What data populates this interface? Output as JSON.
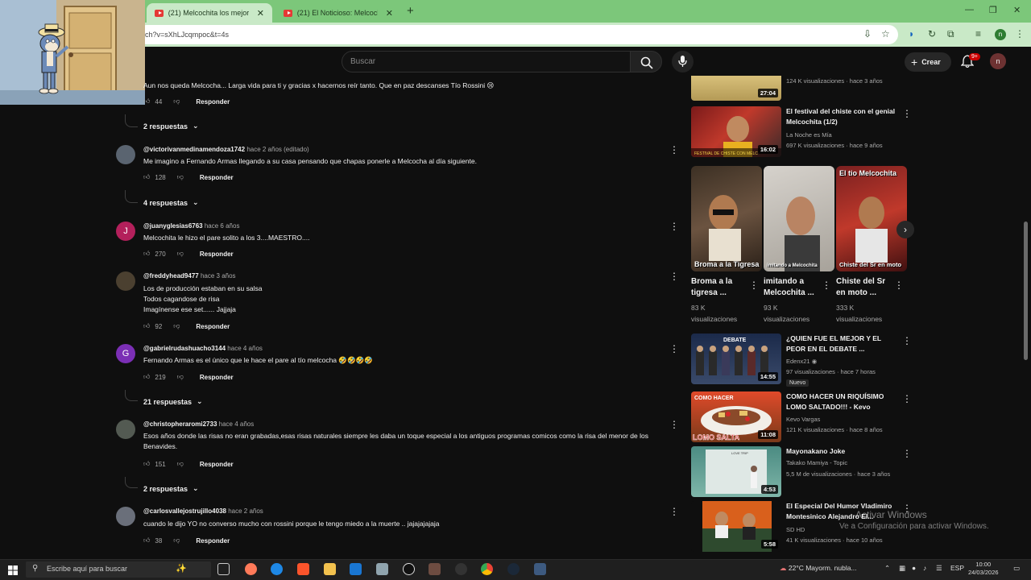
{
  "browser": {
    "tabs": [
      {
        "label": "(21) Melcochita los mejores Ch",
        "active": true
      },
      {
        "label": "(21) El Noticioso: Melcochita al",
        "active": false
      }
    ],
    "url": "ch?v=sXhLJcqmpoc&t=4s"
  },
  "header": {
    "search_placeholder": "Buscar",
    "create_label": "Crear",
    "notif_count": "9+",
    "avatar_letter": "n"
  },
  "comments": [
    {
      "author": "",
      "time": "",
      "text": "Aun nos queda Melcocha... Larga vida para ti y gracias x hacernos reír tanto. Que en paz descanses Tío Rossini 😢",
      "likes": "44",
      "reply": "Responder",
      "replies": "2 respuestas",
      "avatar_letter": ""
    },
    {
      "author": "@victorivanmedinamendoza1742",
      "time": "hace 2 años (editado)",
      "text": "Me imagino a Fernando Armas llegando a su casa pensando que chapas ponerle a Melcocha al día siguiente.",
      "likes": "128",
      "reply": "Responder",
      "replies": "4 respuestas",
      "avatar_letter": ""
    },
    {
      "author": "@juanyglesias6763",
      "time": "hace 6 años",
      "text": "Melcochita le hizo el pare solito a los 3....MAESTRO....",
      "likes": "270",
      "reply": "Responder",
      "replies": "",
      "avatar_letter": "J"
    },
    {
      "author": "@freddyhead9477",
      "time": "hace 3 años",
      "text": "Los de producción estaban en su salsa\nTodos cagandose de risa\nImagínense ese set...... Jajjaja",
      "likes": "92",
      "reply": "Responder",
      "replies": "",
      "avatar_letter": ""
    },
    {
      "author": "@gabrielrudashuacho3144",
      "time": "hace 4 años",
      "text": "Fernando Armas es el único que le hace el pare al tío melcocha 🤣🤣🤣🤣",
      "likes": "219",
      "reply": "Responder",
      "replies": "21 respuestas",
      "avatar_letter": "G"
    },
    {
      "author": "@christopheraromi2733",
      "time": "hace 4 años",
      "text": "Esos años donde las risas no eran grabadas,esas risas naturales siempre les daba un toque especial a los antiguos programas comicos como la risa del menor de los Benavides.",
      "likes": "151",
      "reply": "Responder",
      "replies": "2 respuestas",
      "avatar_letter": ""
    },
    {
      "author": "@carlosvallejostrujillo4038",
      "time": "hace 2 años",
      "text": "cuando le dijo  YO no converso mucho con rossini porque le tengo miedo a la muerte .. jajajajajaja",
      "likes": "38",
      "reply": "Responder",
      "replies": "",
      "avatar_letter": ""
    }
  ],
  "sidebar": {
    "top_meta": "124 K visualizaciones · hace 3 años",
    "top_duration": "27:04",
    "videos": [
      {
        "title": "El festival del chiste con el genial Melcochita (1/2)",
        "channel": "La Noche es Mía",
        "stats": "697 K visualizaciones · hace 9 años",
        "duration": "16:02",
        "badge": ""
      },
      {
        "title": "¿QUIEN FUE EL MEJOR Y EL PEOR EN EL DEBATE ...",
        "channel": "Edenx21",
        "stats": "97 visualizaciones · hace 7 horas",
        "duration": "14:55",
        "badge": "Nuevo"
      },
      {
        "title": "COMO HACER UN RIQUÍSIMO LOMO SALTADO!!! - Kevo",
        "channel": "Kevo Vargas",
        "stats": "121 K visualizaciones · hace 8 años",
        "duration": "11:08",
        "badge": ""
      },
      {
        "title": "Mayonakano Joke",
        "channel": "Takako Mamiya - Topic",
        "stats": "5,5 M de visualizaciones · hace 3 años",
        "duration": "4:53",
        "badge": ""
      },
      {
        "title": "El Especial Del Humor Vladimiro Montesinico Alejandro El...",
        "channel": "SD HD",
        "stats": "41 K visualizaciones · hace 10 años",
        "duration": "5:58",
        "badge": ""
      }
    ],
    "thumb_texts": {
      "festival": "FESTIVAL DE CHISTE CON MELC",
      "debate": "DEBATE",
      "lomo_top": "COMO HACER",
      "lomo_bottom": "LOMO SALTA",
      "love": "LOVE TRIP"
    },
    "shorts": [
      {
        "title": "Broma a la tigresa ...",
        "views": "83 K",
        "views_label": "visualizaciones",
        "caption": "Broma a la Tigresa"
      },
      {
        "title": "imitando a Melcochita ...",
        "views": "93 K",
        "views_label": "visualizaciones",
        "caption": "imitando a Melcochita"
      },
      {
        "title": "Chiste del Sr en moto ...",
        "views": "333 K",
        "views_label": "visualizaciones",
        "caption": "Chiste del Sr en moto",
        "top_caption": "El tio Melcochita"
      }
    ]
  },
  "watermark": {
    "line1": "Activar Windows",
    "line2": "Ve a Configuración para activar Windows."
  },
  "taskbar": {
    "search_placeholder": "Escribe aquí para buscar",
    "weather": "22°C  Mayorm. nubla...",
    "lang": "ESP",
    "time": "10:00",
    "date": "24/03/2026"
  },
  "colors": {
    "tabstrip": "#7cc77a",
    "page_bg": "#0f0f0f",
    "accent_red": "#cc0000"
  }
}
